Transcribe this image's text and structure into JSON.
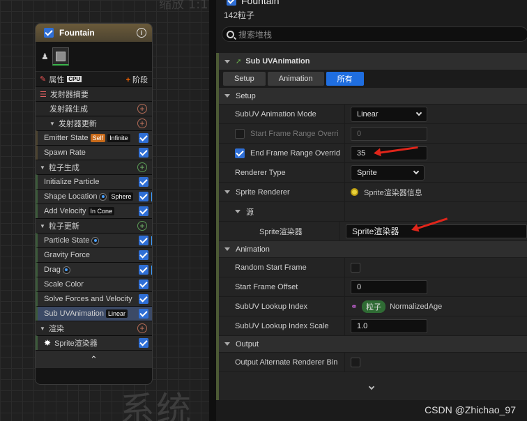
{
  "canvas": {
    "bg_top": "缩放 1:1",
    "bg_bottom": "系统"
  },
  "node": {
    "title": "Fountain",
    "properties_label": "属性",
    "cpu_label": "CPU",
    "stage_label": "阶段",
    "rows": [
      {
        "kind": "section",
        "label": "发射器摘要"
      },
      {
        "kind": "section",
        "label": "发射器生成",
        "add": "r"
      },
      {
        "kind": "section",
        "label": "发射器更新",
        "add": "r"
      },
      {
        "kind": "module",
        "label": "Emitter State",
        "chips": [
          "Self",
          "Infinite"
        ]
      },
      {
        "kind": "module",
        "label": "Spawn Rate"
      },
      {
        "kind": "section",
        "label": "粒子生成",
        "add": "g"
      },
      {
        "kind": "module",
        "label": "Initialize Particle"
      },
      {
        "kind": "module",
        "label": "Shape Location",
        "dot": true,
        "chips": [
          "Sphere"
        ],
        "bar": true
      },
      {
        "kind": "module",
        "label": "Add Velocity",
        "chips": [
          "In Cone"
        ]
      },
      {
        "kind": "section",
        "label": "粒子更新",
        "add": "g"
      },
      {
        "kind": "module",
        "label": "Particle State",
        "dot": true,
        "bar": true
      },
      {
        "kind": "module",
        "label": "Gravity Force"
      },
      {
        "kind": "module",
        "label": "Drag",
        "dot": true,
        "bar": true
      },
      {
        "kind": "module",
        "label": "Scale Color"
      },
      {
        "kind": "module",
        "label": "Solve Forces and Velocity"
      },
      {
        "kind": "module",
        "label": "Sub UVAnimation",
        "chips": [
          "Linear"
        ],
        "selected": true
      },
      {
        "kind": "section",
        "label": "渲染",
        "add": "r"
      },
      {
        "kind": "module",
        "label": "Sprite渲染器",
        "spark": true
      }
    ]
  },
  "panel": {
    "title": "Fountain",
    "particle_count": "142粒子",
    "search_placeholder": "搜索堆栈",
    "module_title": "Sub UVAnimation",
    "tabs": [
      "Setup",
      "Animation",
      "所有"
    ],
    "active_tab": "所有",
    "categories": {
      "setup": "Setup",
      "sprite_renderer": "Sprite Renderer",
      "source": "源",
      "animation": "Animation",
      "output": "Output"
    },
    "props": {
      "mode_label": "SubUV Animation Mode",
      "mode_value": "Linear",
      "start_label": "Start Frame Range Overri",
      "start_value": "0",
      "end_label": "End Frame Range Overrid",
      "end_value": "35",
      "renderer_label": "Renderer Type",
      "renderer_value": "Sprite",
      "sprite_info": "Sprite渲染器信息",
      "sprite_sub_label": "Sprite渲染器",
      "sprite_sub_value": "Sprite渲染器",
      "random_label": "Random Start Frame",
      "offset_label": "Start Frame Offset",
      "offset_value": "0",
      "lookup_label": "SubUV Lookup Index",
      "lookup_chip": "粒子",
      "lookup_value": "NormalizedAge",
      "lookup_scale_label": "SubUV Lookup Index Scale",
      "lookup_scale_value": "1.0",
      "output_label": "Output Alternate Renderer Bin"
    },
    "checkbox_states": {
      "start_override": false,
      "end_override": true,
      "random_start": false,
      "output_alt": false
    }
  },
  "watermark": "CSDN @Zhichao_97",
  "colors": {
    "accent": "#1f6ee0",
    "arrow": "#e0251a",
    "module_frame": "#4c5a35"
  }
}
